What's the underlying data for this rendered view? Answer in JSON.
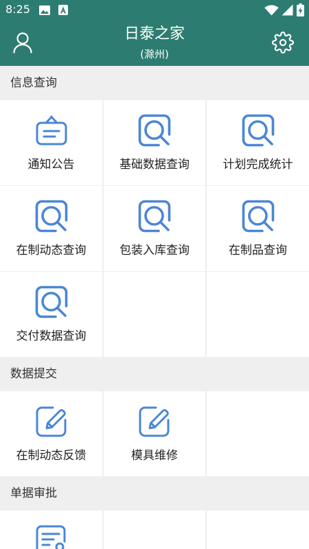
{
  "status_bar": {
    "time": "8:25",
    "icons": [
      "image-icon",
      "a-badge-icon",
      "wifi-icon",
      "signal-icon",
      "battery-charging-icon"
    ]
  },
  "header": {
    "title": "日泰之家",
    "subtitle": "(滁州)",
    "left_icon": "user-icon",
    "right_icon": "gear-icon"
  },
  "colors": {
    "primary": "#2d7c71",
    "icon": "#4a86d6",
    "section-bg": "#efefef",
    "text": "#222222"
  },
  "sections": [
    {
      "title": "信息查询",
      "items": [
        {
          "label": "通知公告",
          "icon": "notice-board-icon"
        },
        {
          "label": "基础数据查询",
          "icon": "search-icon"
        },
        {
          "label": "计划完成统计",
          "icon": "search-icon"
        },
        {
          "label": "在制动态查询",
          "icon": "search-icon"
        },
        {
          "label": "包装入库查询",
          "icon": "search-icon"
        },
        {
          "label": "在制品查询",
          "icon": "search-icon"
        },
        {
          "label": "交付数据查询",
          "icon": "search-icon"
        }
      ]
    },
    {
      "title": "数据提交",
      "items": [
        {
          "label": "在制动态反馈",
          "icon": "edit-icon"
        },
        {
          "label": "模具维修",
          "icon": "edit-icon"
        }
      ]
    },
    {
      "title": "单据审批",
      "items": [
        {
          "icon": "document-approval-icon"
        }
      ]
    }
  ]
}
